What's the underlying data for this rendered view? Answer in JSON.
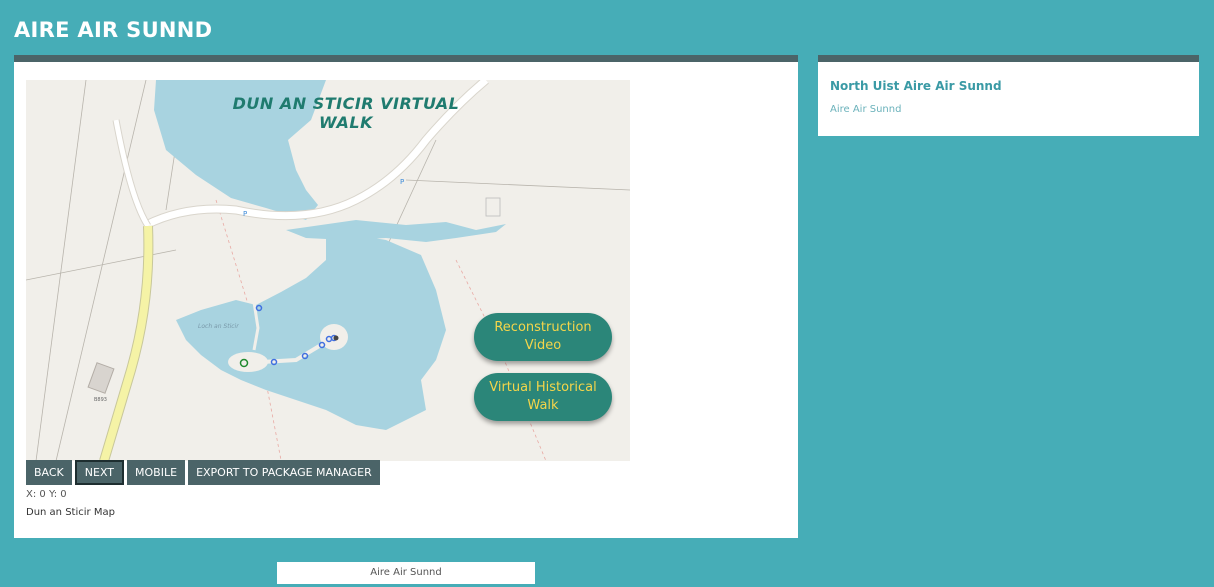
{
  "header": {
    "title": "AIRE AIR SUNND"
  },
  "map": {
    "title": "DUN AN STICIR VIRTUAL WALK",
    "buttons": {
      "reconstruction": "Reconstruction Video",
      "walk": "Virtual Historical Walk"
    }
  },
  "toolbar": {
    "back": "BACK",
    "next": "NEXT",
    "mobile": "MOBILE",
    "export": "EXPORT TO PACKAGE MANAGER"
  },
  "coords": "X: 0 Y: 0",
  "caption": "Dun an Sticir Map",
  "sidebar": {
    "title": "North Uist Aire Air Sunnd",
    "subtitle": "Aire Air Sunnd"
  },
  "footer": {
    "label": "Aire Air Sunnd"
  },
  "colors": {
    "background": "#46adb7",
    "panel_header": "#4b6468",
    "map_button": "#2b8679",
    "map_button_text": "#f4d54a",
    "water": "#a8d3e0"
  }
}
